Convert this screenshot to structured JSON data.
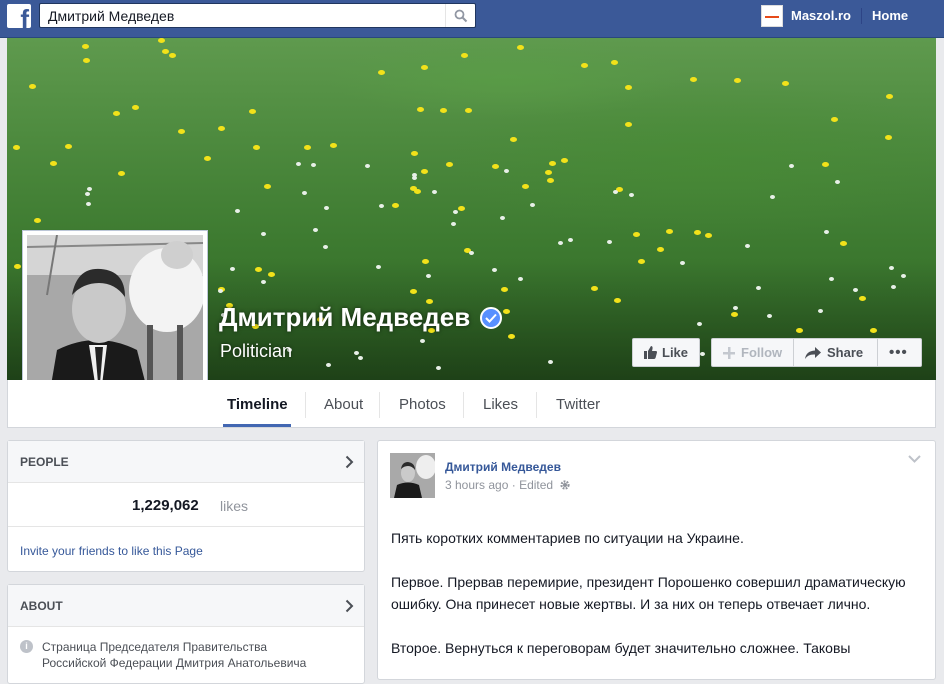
{
  "topbar": {
    "search_value": "Дмитрий Медведев",
    "user_name": "Maszol.ro",
    "home_label": "Home",
    "brand_color": "#3b5998"
  },
  "page": {
    "name": "Дмитрий Медведев",
    "category": "Politician",
    "verified": true
  },
  "actions": {
    "like": "Like",
    "follow": "Follow",
    "share": "Share",
    "more": "•••"
  },
  "tabs": [
    {
      "label": "Timeline",
      "active": true
    },
    {
      "label": "About"
    },
    {
      "label": "Photos"
    },
    {
      "label": "Likes"
    },
    {
      "label": "Twitter"
    }
  ],
  "people_box": {
    "title": "PEOPLE",
    "likes_count": "1,229,062",
    "likes_unit": "likes",
    "invite_text": "Invite your friends to like this Page"
  },
  "about_box": {
    "title": "ABOUT",
    "line1": "Страница Председателя Правительства",
    "line2": "Российской Федерации Дмитрия Анатольевича"
  },
  "post": {
    "author": "Дмитрий Медведев",
    "time": "3 hours ago",
    "separator": "·",
    "edited": "Edited",
    "paragraphs": [
      "Пять коротких комментариев по ситуации на Украине.",
      "Первое. Прервав перемирие, президент Порошенко совершил драматическую ошибку. Она принесет новые жертвы. И за них он теперь отвечает лично.",
      "Второе. Вернуться к переговорам будет значительно сложнее. Таковы"
    ]
  }
}
